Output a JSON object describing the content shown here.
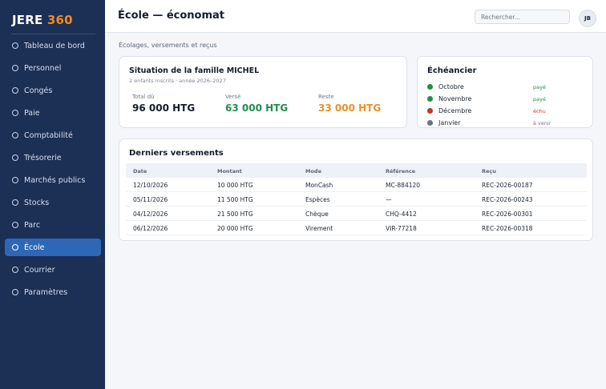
{
  "app": {
    "brand_main": "JERE",
    "brand_accent": "360"
  },
  "sidebar": {
    "items": [
      {
        "label": "Tableau de bord",
        "active": false
      },
      {
        "label": "Personnel",
        "active": false
      },
      {
        "label": "Congés",
        "active": false
      },
      {
        "label": "Paie",
        "active": false
      },
      {
        "label": "Comptabilité",
        "active": false
      },
      {
        "label": "Trésorerie",
        "active": false
      },
      {
        "label": "Marchés publics",
        "active": false
      },
      {
        "label": "Stocks",
        "active": false
      },
      {
        "label": "Parc",
        "active": false
      },
      {
        "label": "École",
        "active": true
      },
      {
        "label": "Courrier",
        "active": false
      },
      {
        "label": "Paramètres",
        "active": false
      }
    ]
  },
  "header": {
    "title": "École — économat",
    "search_placeholder": "Rechercher...",
    "avatar_initials": "JB"
  },
  "main": {
    "subtitle": "Écolages, versements et reçus",
    "family": {
      "title": "Situation de la famille MICHEL",
      "subtitle": "2 enfants inscrits · année 2026–2027",
      "stats": [
        {
          "label": "Total dû",
          "value": "96 000 HTG"
        },
        {
          "label": "Versé",
          "value": "63 000 HTG"
        },
        {
          "label": "Reste",
          "value": "33 000 HTG"
        }
      ]
    },
    "schedule": {
      "title": "Échéancier",
      "rows": [
        {
          "month": "Octobre",
          "status": "payé",
          "color": "#1f8f4a"
        },
        {
          "month": "Novembre",
          "status": "payé",
          "color": "#1f8f4a"
        },
        {
          "month": "Décembre",
          "status": "échu",
          "color": "#c0392b"
        },
        {
          "month": "Janvier",
          "status": "à venir",
          "color": "#6b7280"
        }
      ]
    },
    "payments": {
      "title": "Derniers versements",
      "columns": [
        "Date",
        "Montant",
        "Mode",
        "Référence",
        "Reçu"
      ],
      "rows": [
        [
          "12/10/2026",
          "10 000 HTG",
          "MonCash",
          "MC-884120",
          "REC-2026-00187"
        ],
        [
          "05/11/2026",
          "11 500 HTG",
          "Espèces",
          "—",
          "REC-2026-00243"
        ],
        [
          "04/12/2026",
          "21 500 HTG",
          "Chèque",
          "CHQ-4412",
          "REC-2026-00301"
        ],
        [
          "06/12/2026",
          "20 000 HTG",
          "Virement",
          "VIR-77218",
          "REC-2026-00318"
        ]
      ]
    }
  },
  "colors": {
    "sidebar_bg": "#1c2f55",
    "brand_accent": "#f08a24",
    "active_nav": "#2e67b6",
    "paid_green": "#1f8f4a",
    "due_red": "#c0392b",
    "remaining_orange": "#ef8e22"
  }
}
